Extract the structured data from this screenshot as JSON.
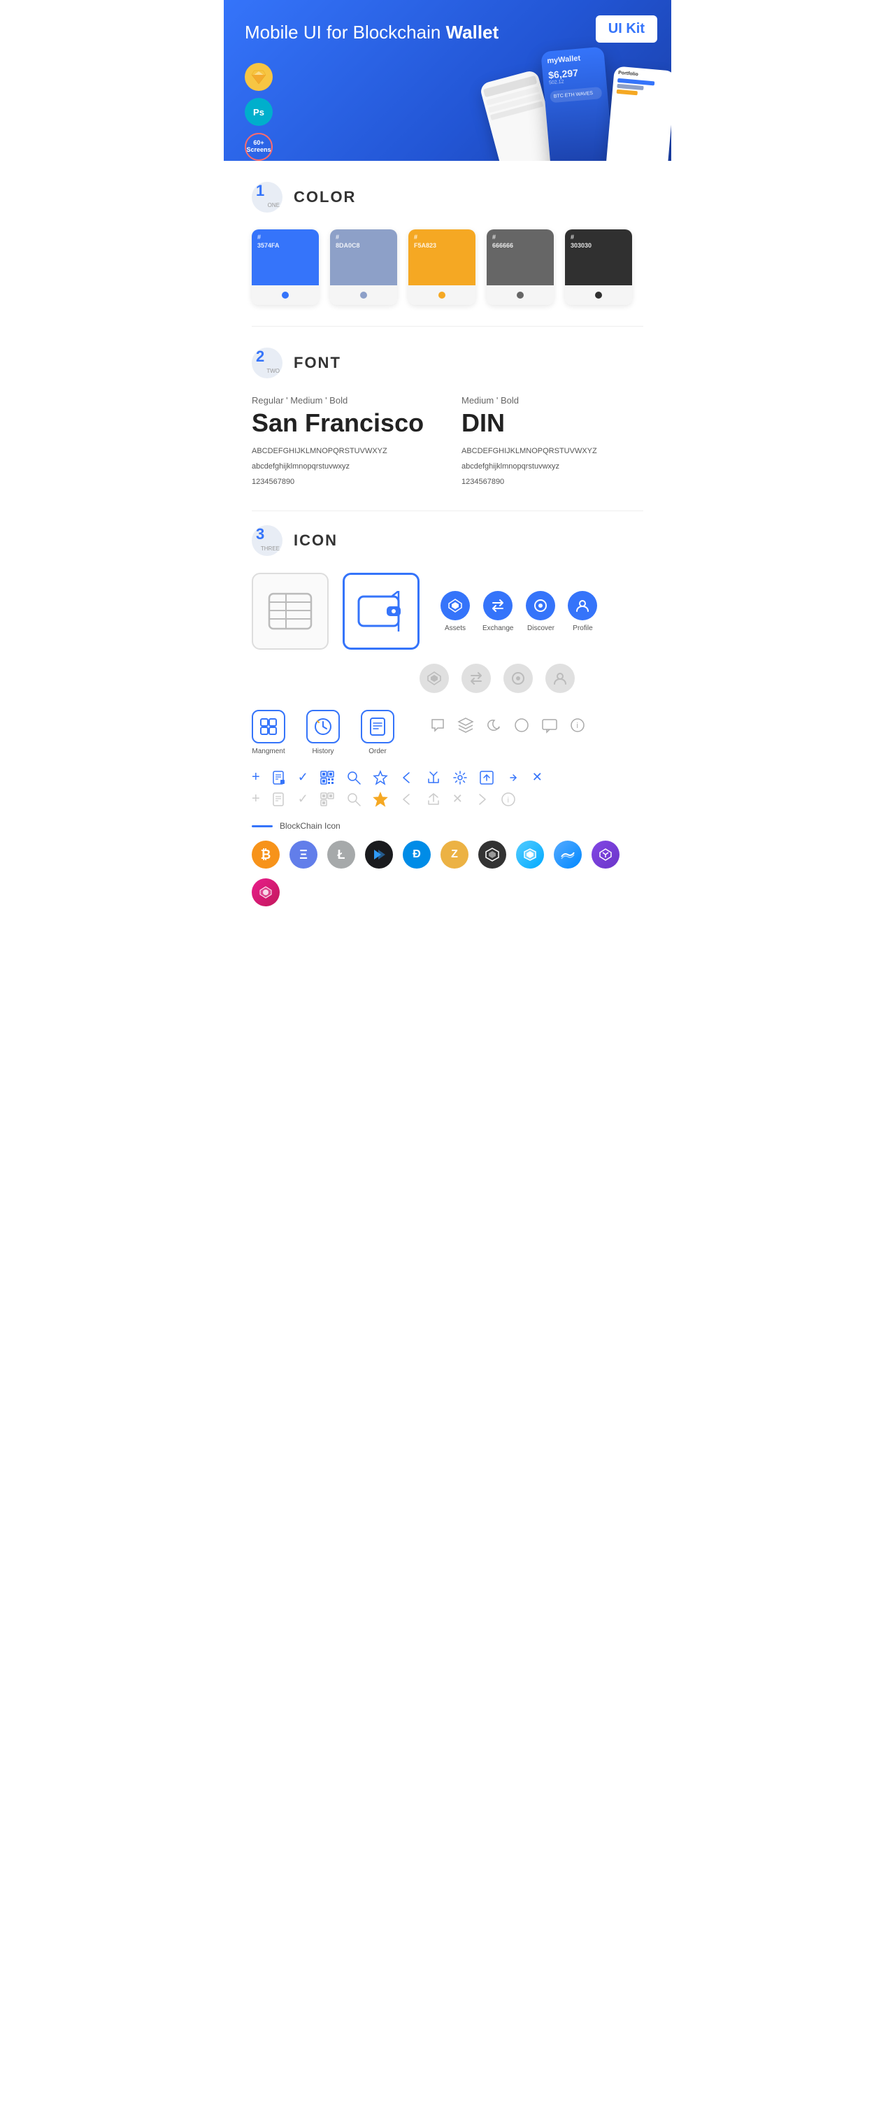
{
  "hero": {
    "title_normal": "Mobile UI for Blockchain ",
    "title_bold": "Wallet",
    "badge": "UI Kit",
    "sketch_label": "Sk",
    "ps_label": "Ps",
    "screens_label": "60+\nScreens"
  },
  "colors": {
    "section_num": "1",
    "section_label": "ONE",
    "section_title": "COLOR",
    "items": [
      {
        "hex": "#\n3574FA",
        "swatch": "#3574FA",
        "dot": "#3574FA"
      },
      {
        "hex": "#\n8DA0C8",
        "swatch": "#8DA0C8",
        "dot": "#8DA0C8"
      },
      {
        "hex": "#\nF5A823",
        "swatch": "#F5A823",
        "dot": "#F5A823"
      },
      {
        "hex": "#\n666666",
        "swatch": "#666666",
        "dot": "#666666"
      },
      {
        "hex": "#\n303030",
        "swatch": "#303030",
        "dot": "#303030"
      }
    ]
  },
  "fonts": {
    "section_num": "2",
    "section_label": "TWO",
    "section_title": "FONT",
    "font1": {
      "styles": "Regular ' Medium ' Bold",
      "name": "San Francisco",
      "uppercase": "ABCDEFGHIJKLMNOPQRSTUVWXYZ",
      "lowercase": "abcdefghijklmnopqrstuvwxyz",
      "numbers": "1234567890"
    },
    "font2": {
      "styles": "Medium ' Bold",
      "name": "DIN",
      "uppercase": "ABCDEFGHIJKLMNOPQRSTUVWXYZ",
      "lowercase": "abcdefghijklmnopqrstuvwxyz",
      "numbers": "1234567890"
    }
  },
  "icons": {
    "section_num": "3",
    "section_label": "THREE",
    "section_title": "ICON",
    "tab_icons": [
      {
        "label": "Assets",
        "symbol": "◆"
      },
      {
        "label": "Exchange",
        "symbol": "⇄"
      },
      {
        "label": "Discover",
        "symbol": "●"
      },
      {
        "label": "Profile",
        "symbol": "👤"
      }
    ],
    "app_icons": [
      {
        "label": "Mangment",
        "symbol": "▤"
      },
      {
        "label": "History",
        "symbol": "🕐"
      },
      {
        "label": "Order",
        "symbol": "📋"
      }
    ],
    "tools_row1": [
      "+",
      "⊞",
      "✓",
      "⊠",
      "🔍",
      "☆",
      "<",
      "<>",
      "⚙",
      "⊡",
      "⇆",
      "✕"
    ],
    "tools_row2": [
      "+",
      "⊞",
      "✓",
      "⊠",
      "🔍",
      "☆",
      "<",
      "<>",
      "✕",
      "→",
      "ℹ"
    ],
    "bc_label": "BlockChain Icon"
  },
  "crypto": [
    {
      "symbol": "₿",
      "class": "ci-btc"
    },
    {
      "symbol": "Ξ",
      "class": "ci-eth"
    },
    {
      "symbol": "Ł",
      "class": "ci-ltc"
    },
    {
      "symbol": "⬡",
      "class": "ci-btcp"
    },
    {
      "symbol": "Đ",
      "class": "ci-dash"
    },
    {
      "symbol": "Z",
      "class": "ci-zcash"
    },
    {
      "symbol": "⬡",
      "class": "ci-grid"
    },
    {
      "symbol": "▲",
      "class": "ci-status"
    },
    {
      "symbol": "◆",
      "class": "ci-waves"
    },
    {
      "symbol": "∞",
      "class": "ci-matic"
    },
    {
      "symbol": "◉",
      "class": "ci-poly"
    }
  ]
}
